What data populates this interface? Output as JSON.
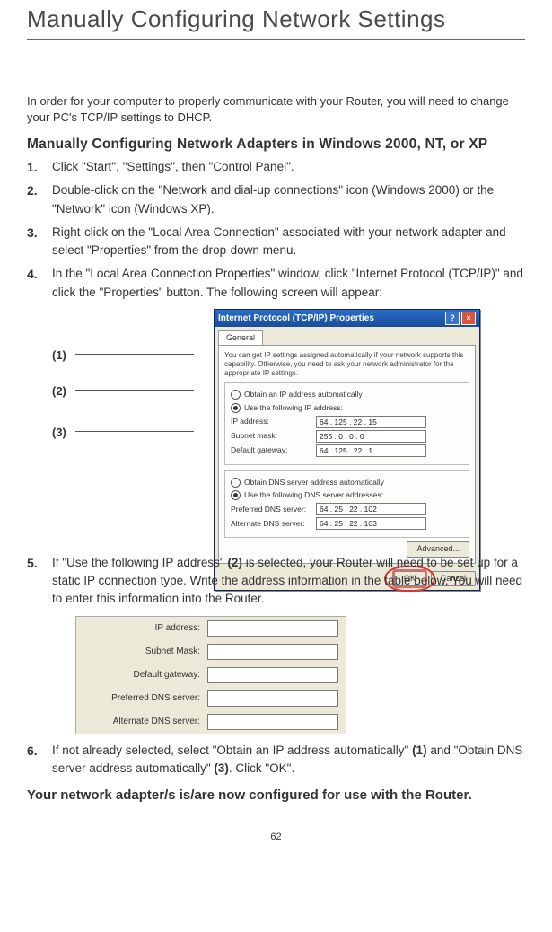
{
  "page_title": "Manually Configuring Network Settings",
  "intro": "In order for your computer to properly communicate with your Router, you will need to change your PC's TCP/IP settings to DHCP.",
  "section_head": "Manually Configuring Network Adapters in Windows 2000, NT, or XP",
  "steps": {
    "s1_num": "1.",
    "s1": "Click \"Start\", \"Settings\", then \"Control Panel\".",
    "s2_num": "2.",
    "s2": "Double-click on the \"Network and dial-up connections\" icon (Windows 2000) or the \"Network\" icon (Windows XP).",
    "s3_num": "3.",
    "s3": "Right-click on the \"Local Area Connection\" associated with your network adapter and select \"Properties\" from the drop-down menu.",
    "s4_num": "4.",
    "s4": "In the \"Local Area Connection Properties\" window, click \"Internet Protocol (TCP/IP)\" and click the \"Properties\" button. The following screen will appear:",
    "s5_num": "5.",
    "s5_a": "If \"Use the following IP address\" ",
    "s5_ref": "(2)",
    "s5_b": " is selected, your Router will need to be set up for a static IP connection type. Write the address information in the table below. You will need to enter this information into the Router.",
    "s6_num": "6.",
    "s6_a": "If not already selected, select \"Obtain an IP address automatically\" ",
    "s6_ref1": "(1)",
    "s6_mid": " and \"Obtain DNS server address automatically\" ",
    "s6_ref2": "(3)",
    "s6_end": ". Click \"OK\"."
  },
  "callouts": {
    "c1": "(1)",
    "c2": "(2)",
    "c3": "(3)"
  },
  "dialog": {
    "title": "Internet Protocol (TCP/IP) Properties",
    "help": "?",
    "close": "×",
    "tab": "General",
    "desc": "You can get IP settings assigned automatically if your network supports this capability. Otherwise, you need to ask your network administrator for the appropriate IP settings.",
    "r_auto_ip": "Obtain an IP address automatically",
    "r_use_ip": "Use the following IP address:",
    "lbl_ip": "IP address:",
    "val_ip": "64 . 125 . 22 . 15",
    "lbl_mask": "Subnet mask:",
    "val_mask": "255 .  0  .  0  .  0",
    "lbl_gw": "Default gateway:",
    "val_gw": "64 . 125 . 22 .  1",
    "r_auto_dns": "Obtain DNS server address automatically",
    "r_use_dns": "Use the following DNS server addresses:",
    "lbl_pdns": "Preferred DNS server:",
    "val_pdns": "64 .  25 .  22 . 102",
    "lbl_adns": "Alternate DNS server:",
    "val_adns": "64 .  25 .  22 . 103",
    "btn_adv": "Advanced...",
    "btn_ok": "OK",
    "btn_cancel": "Cancel"
  },
  "ipform": {
    "ip": "IP address:",
    "mask": "Subnet Mask:",
    "gw": "Default gateway:",
    "pdns": "Preferred DNS server:",
    "adns": "Alternate DNS server:"
  },
  "closing": "Your network adapter/s is/are now configured for use with the Router.",
  "pagenum": "62"
}
